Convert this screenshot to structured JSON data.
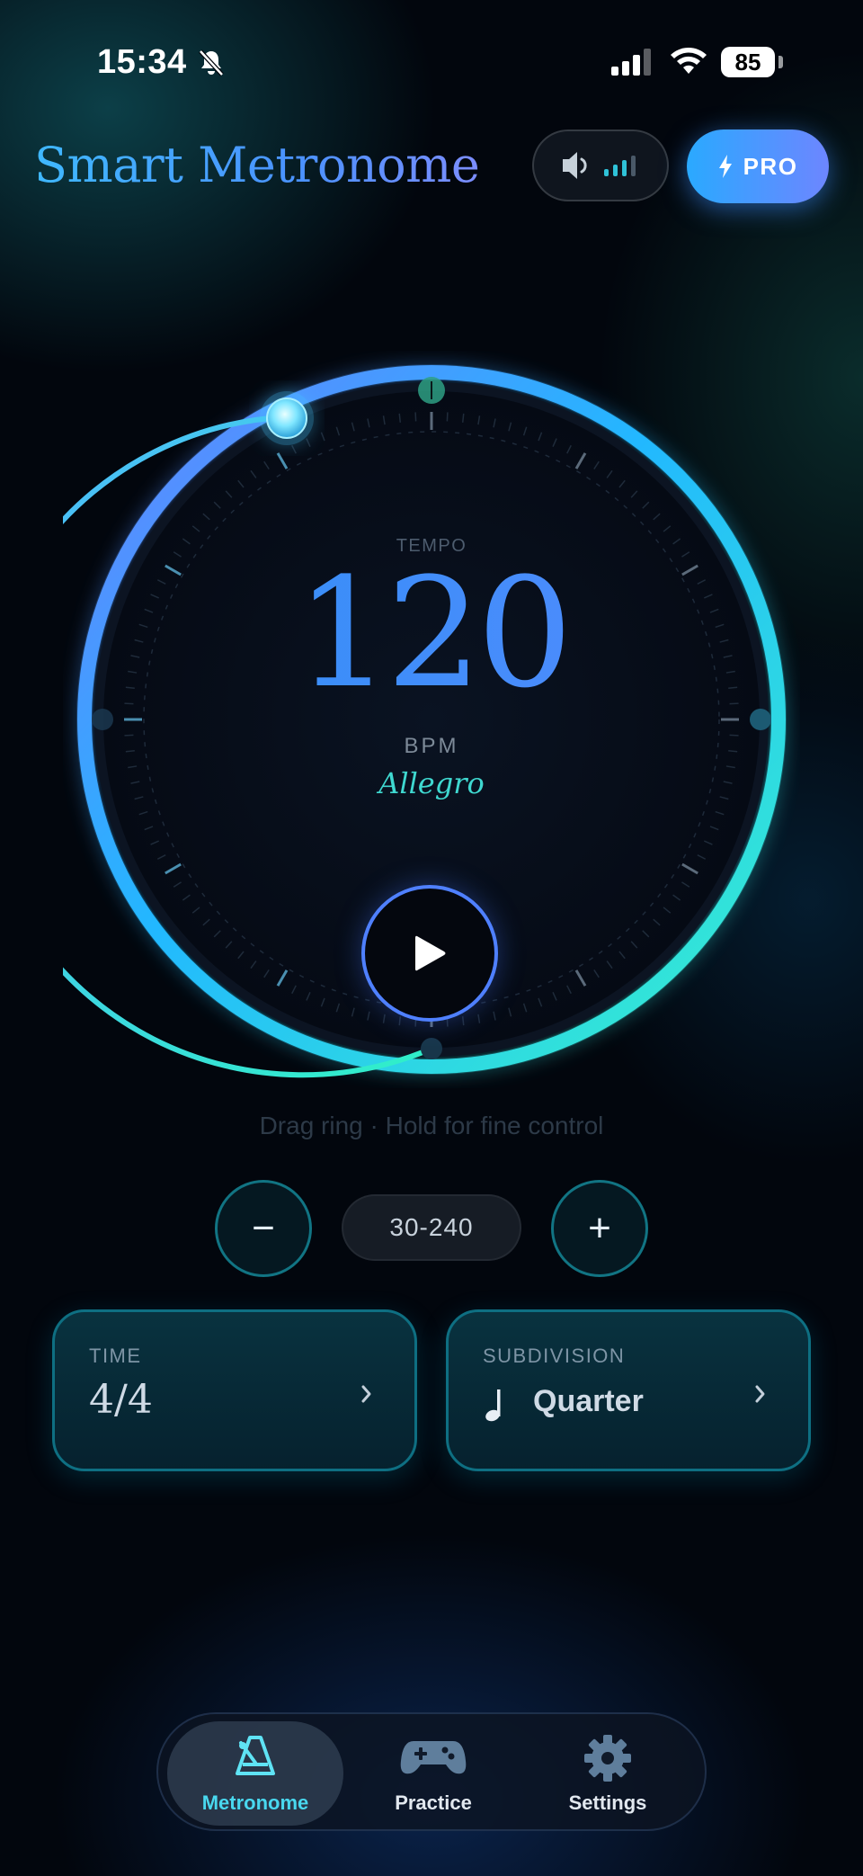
{
  "status_bar": {
    "time": "15:34",
    "battery": "85",
    "icons": [
      "bell-slash-icon",
      "cellular-signal-icon",
      "wifi-icon",
      "battery-icon"
    ]
  },
  "header": {
    "title": "Smart Metronome",
    "volume_icon": "speaker-icon",
    "volume_level": "3/4",
    "pro_label": "PRO",
    "pro_icon": "lightning-icon"
  },
  "dial": {
    "tempo_label": "TEMPO",
    "bpm": "120",
    "unit": "BPM",
    "tempo_name": "Allegro",
    "play_icon": "play-icon",
    "colors": {
      "arc_start": "#6a7dff",
      "arc_end": "#37f2cc",
      "accent": "#49d8ef"
    }
  },
  "hint": "Drag ring · Hold for fine control",
  "stepper": {
    "minus": "−",
    "plus": "+",
    "range": "30-240"
  },
  "cards": {
    "time": {
      "label": "TIME",
      "value": "4/4"
    },
    "subdivision": {
      "label": "SUBDIVISION",
      "value": "Quarter",
      "icon": "quarter-note-icon"
    }
  },
  "tabs": [
    {
      "label": "Metronome",
      "icon": "metronome-icon",
      "active": true
    },
    {
      "label": "Practice",
      "icon": "gamepad-icon",
      "active": false
    },
    {
      "label": "Settings",
      "icon": "gear-icon",
      "active": false
    }
  ]
}
